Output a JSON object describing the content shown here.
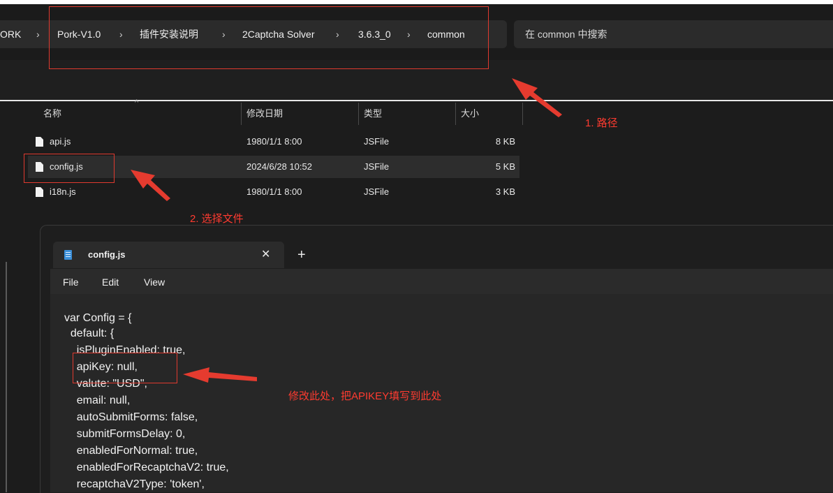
{
  "breadcrumb": {
    "items": [
      "ORK",
      "Pork-V1.0",
      "插件安装说明",
      "2Captcha Solver",
      "3.6.3_0",
      "common"
    ],
    "separator": "›"
  },
  "search": {
    "placeholder": "在 common 中搜索"
  },
  "file_list": {
    "columns": [
      "名称",
      "修改日期",
      "类型",
      "大小"
    ],
    "rows": [
      {
        "name": "api.js",
        "modified": "1980/1/1 8:00",
        "type": "JSFile",
        "size": "8 KB"
      },
      {
        "name": "config.js",
        "modified": "2024/6/28 10:52",
        "type": "JSFile",
        "size": "5 KB"
      },
      {
        "name": "i18n.js",
        "modified": "1980/1/1 8:00",
        "type": "JSFile",
        "size": "3 KB"
      }
    ]
  },
  "annotations": {
    "path": "1. 路径",
    "select_file": "2. 选择文件",
    "modify_here": "修改此处，把APIKEY填写到此处",
    "color": "#ff3b30"
  },
  "notepad": {
    "tab_title": "config.js",
    "close_glyph": "✕",
    "new_tab_glyph": "+",
    "menu": [
      "File",
      "Edit",
      "View"
    ],
    "code_lines": [
      "var Config = {",
      "  default: {",
      "    isPluginEnabled: true,",
      "    apiKey: null,",
      "    valute: \"USD\",",
      "    email: null,",
      "    autoSubmitForms: false,",
      "    submitFormsDelay: 0,",
      "    enabledForNormal: true,",
      "    enabledForRecaptchaV2: true,",
      "    recaptchaV2Type: 'token',"
    ]
  },
  "icons": {
    "file": "file-icon",
    "notepad": "notepad-icon",
    "sort": "sort-ascending-icon"
  }
}
